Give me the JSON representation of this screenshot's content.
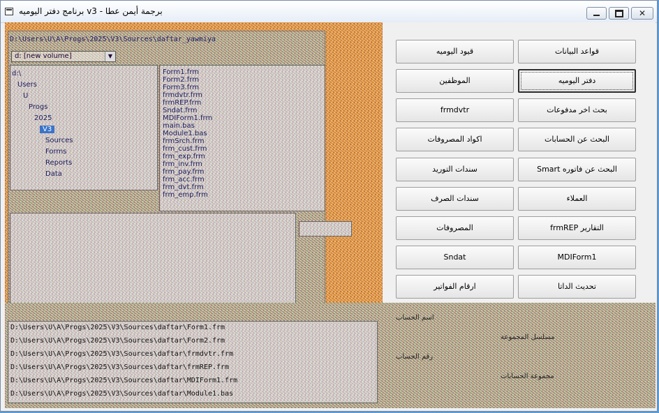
{
  "window": {
    "title": "برجمة أيمن عطا - v3 برنامج دفتر اليوميه"
  },
  "explorer": {
    "path": "D:\\Users\\U\\A\\Progs\\2025\\V3\\Sources\\daftar_yawmiya",
    "drive": "d: [new volume]",
    "tree_items": [
      "d:\\",
      "Users",
      "U",
      "Progs",
      "2025",
      "V3",
      "Sources",
      "Forms",
      "Reports",
      "Data"
    ],
    "selected_tree_index": 5,
    "files": [
      "Form1.frm",
      "Form2.frm",
      "Form3.frm",
      "frmdvtr.frm",
      "frmREP.frm",
      "Sndat.frm",
      "MDIForm1.frm",
      "main.bas",
      "Module1.bas",
      "frmSrch.frm",
      "frm_cust.frm",
      "frm_exp.frm",
      "frm_inv.frm",
      "frm_pay.frm",
      "frm_acc.frm",
      "frm_dvt.frm",
      "frm_emp.frm"
    ]
  },
  "log_lines": [
    "D:\\Users\\U\\A\\Progs\\2025\\V3\\Sources\\daftar\\Form1.frm",
    "D:\\Users\\U\\A\\Progs\\2025\\V3\\Sources\\daftar\\Form2.frm",
    "D:\\Users\\U\\A\\Progs\\2025\\V3\\Sources\\daftar\\frmdvtr.frm",
    "D:\\Users\\U\\A\\Progs\\2025\\V3\\Sources\\daftar\\frmREP.frm",
    "D:\\Users\\U\\A\\Progs\\2025\\V3\\Sources\\daftar\\MDIForm1.frm",
    "D:\\Users\\U\\A\\Progs\\2025\\V3\\Sources\\daftar\\Module1.bas"
  ],
  "menu": {
    "right_column": [
      "قواعد البيانات",
      "دفتر اليوميه",
      "بحث اخر مدفوعات",
      "البحث عن الحسابات",
      "Smart البحث عن فاتوره",
      "العملاء",
      "frmREP      التقارير",
      "MDIForm1",
      "تحديث الداتا"
    ],
    "left_column": [
      "قيود اليوميه",
      "الموظفين",
      "frmdvtr",
      "اكواد المصروفات",
      "سندات التوريد",
      "سندات الصرف",
      "المصروفات",
      "Sndat",
      "ارقام الفواتير"
    ]
  },
  "lower_labels": [
    "اسم الحساب",
    "مسلسل المجموعة",
    "رقم الحساب",
    "مجموعة الحسابات"
  ]
}
